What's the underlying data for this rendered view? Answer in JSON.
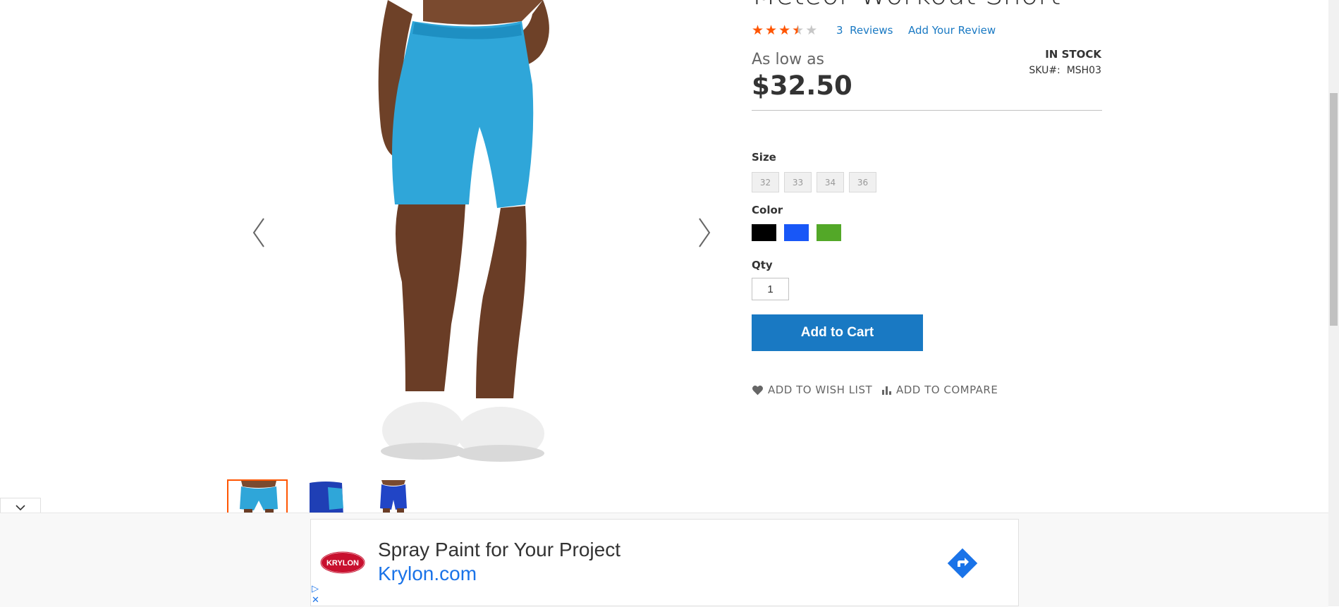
{
  "product": {
    "title": "Meteor Workout Short",
    "rating_percent": 70,
    "reviews_count": "3",
    "reviews_label": "Reviews",
    "add_review": "Add Your Review",
    "price_prefix": "As low as",
    "price": "$32.50",
    "stock": "IN STOCK",
    "sku_label": "SKU#:",
    "sku_value": "MSH03"
  },
  "options": {
    "size_label": "Size",
    "sizes": [
      "32",
      "33",
      "34",
      "36"
    ],
    "color_label": "Color",
    "colors": [
      {
        "name": "Black",
        "hex": "#000000"
      },
      {
        "name": "Blue",
        "hex": "#1857f7"
      },
      {
        "name": "Green",
        "hex": "#53a828"
      }
    ],
    "qty_label": "Qty",
    "qty_value": "1"
  },
  "actions": {
    "add_to_cart": "Add to Cart",
    "wishlist": "ADD TO WISH LIST",
    "compare": "ADD TO COMPARE"
  },
  "colors": {
    "accent": "#1979c3",
    "star_on": "#ff5501",
    "star_off": "#c7c7c7",
    "short_blue": "#2fa6d9"
  },
  "ad": {
    "logo_text": "KRYLON",
    "title": "Spray Paint for Your Project",
    "url": "Krylon.com"
  }
}
